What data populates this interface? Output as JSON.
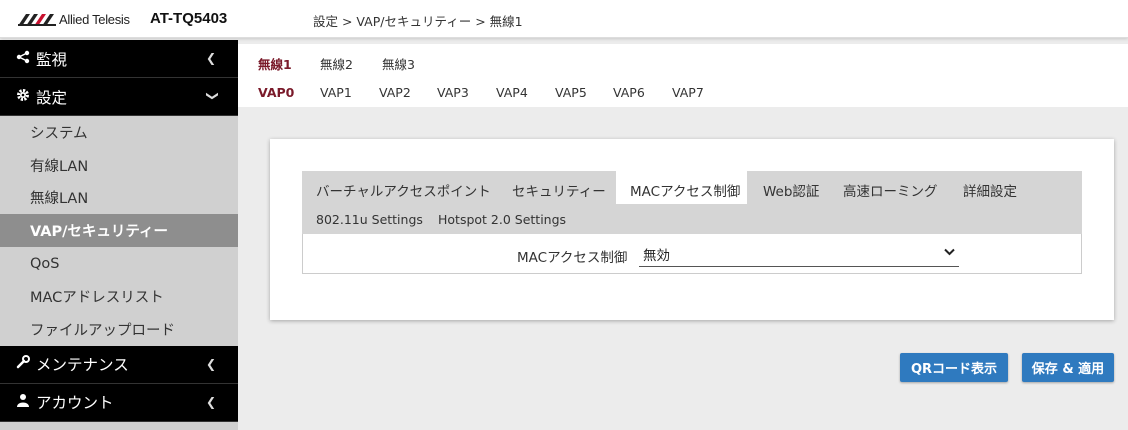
{
  "header": {
    "logo_text": "Allied Telesis",
    "model": "AT-TQ5403",
    "breadcrumb": "設定 > VAP/セキュリティー > 無線1"
  },
  "sidebar": {
    "sections": [
      {
        "label": "監視",
        "icon": "share-icon"
      },
      {
        "label": "設定",
        "icon": "gear-icon"
      },
      {
        "label": "メンテナンス",
        "icon": "wrench-icon"
      },
      {
        "label": "アカウント",
        "icon": "user-icon"
      }
    ],
    "items": [
      {
        "label": "システム"
      },
      {
        "label": "有線LAN"
      },
      {
        "label": "無線LAN"
      },
      {
        "label": "VAP/セキュリティー"
      },
      {
        "label": "QoS"
      },
      {
        "label": "MACアドレスリスト"
      },
      {
        "label": "ファイルアップロード"
      }
    ]
  },
  "radio_tabs": [
    "無線1",
    "無線2",
    "無線3"
  ],
  "vap_tabs": [
    "VAP0",
    "VAP1",
    "VAP2",
    "VAP3",
    "VAP4",
    "VAP5",
    "VAP6",
    "VAP7"
  ],
  "inner_tabs": {
    "row1": [
      "バーチャルアクセスポイント",
      "セキュリティー",
      "MACアクセス制御",
      "Web認証",
      "高速ローミング",
      "詳細設定"
    ],
    "row2": [
      "802.11u Settings",
      "Hotspot 2.0 Settings"
    ]
  },
  "form": {
    "mac_access_label": "MACアクセス制御",
    "mac_access_value": "無効"
  },
  "buttons": {
    "qr": "QRコード表示",
    "save": "保存 & 適用"
  },
  "colors": {
    "accent": "#7a1a2a",
    "button": "#2f7abf",
    "sidebar_section": "#000000",
    "sidebar_active": "#8e8e8e"
  }
}
